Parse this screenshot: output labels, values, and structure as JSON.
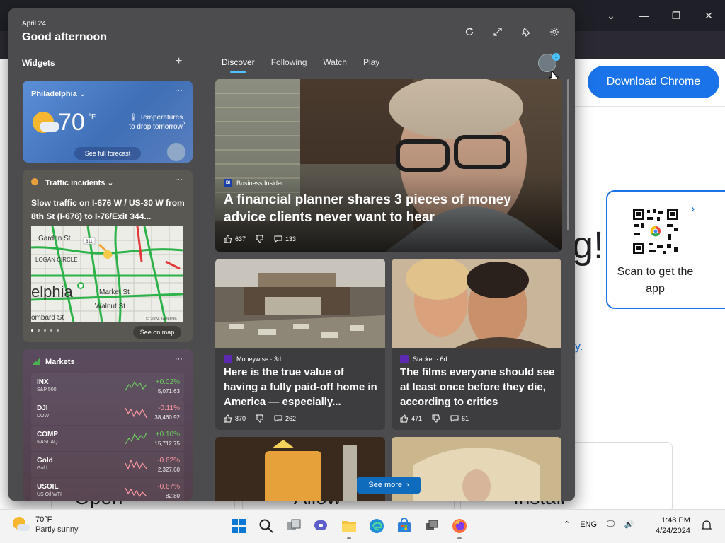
{
  "background": {
    "download_label": "Download Chrome",
    "qr_text": "Scan to get the app",
    "heading_fragment": "g!",
    "link_fragment": "y.",
    "card_labels": [
      "Open",
      "Allow",
      "Install"
    ]
  },
  "panel": {
    "date": "April 24",
    "greeting": "Good afternoon",
    "widgets_title": "Widgets",
    "tabs": [
      {
        "label": "Discover",
        "active": true
      },
      {
        "label": "Following",
        "active": false
      },
      {
        "label": "Watch",
        "active": false
      },
      {
        "label": "Play",
        "active": false
      }
    ],
    "profile_badge": "1"
  },
  "weather": {
    "city": "Philadelphia",
    "temp": "70",
    "unit": "°F",
    "message": "Temperatures to drop tomorrow",
    "button": "See full forecast"
  },
  "traffic": {
    "title": "Traffic incidents",
    "description": "Slow traffic on I-676 W / US-30 W from 8th St (I-676) to I-76/Exit 344...",
    "map_labels": [
      "Garden St",
      "LOGAN CIRCLE",
      "elphia",
      "Market St",
      "Walnut St",
      "ombard St"
    ],
    "map_credit": "© 2024 TomTom",
    "button": "See on map"
  },
  "markets": {
    "title": "Markets",
    "rows": [
      {
        "symbol": "INX",
        "index": "S&P 500",
        "change": "+0.02%",
        "value": "5,071.63",
        "up": true
      },
      {
        "symbol": "DJI",
        "index": "DOW",
        "change": "-0.11%",
        "value": "38,460.92",
        "up": false
      },
      {
        "symbol": "COMP",
        "index": "NASDAQ",
        "change": "+0.10%",
        "value": "15,712.75",
        "up": true
      },
      {
        "symbol": "Gold",
        "index": "Gold",
        "change": "-0.62%",
        "value": "2,327.60",
        "up": false
      },
      {
        "symbol": "USOIL",
        "index": "US Oil WTI",
        "change": "-0.67%",
        "value": "82.80",
        "up": false
      }
    ]
  },
  "hero": {
    "source": "Business Insider",
    "source_logo": "BI",
    "title": "A financial planner shares 3 pieces of money advice clients never want to hear",
    "likes": "637",
    "comments": "133"
  },
  "cards": [
    {
      "source": "Moneywise · 3d",
      "title": "Here is the true value of having a fully paid-off home in America — especially...",
      "likes": "870",
      "comments": "262"
    },
    {
      "source": "Stacker · 6d",
      "title": "The films everyone should see at least once before they die, according to critics",
      "likes": "471",
      "comments": "61"
    }
  ],
  "see_more": "See more",
  "taskbar": {
    "weather_temp": "70°F",
    "weather_cond": "Partly sunny",
    "lang": "ENG",
    "time": "1:48 PM",
    "date": "4/24/2024"
  },
  "colors": {
    "accent": "#4cc2ff",
    "up": "#6ccb5f",
    "down": "#ff99a4",
    "chrome_blue": "#1a73e8"
  }
}
